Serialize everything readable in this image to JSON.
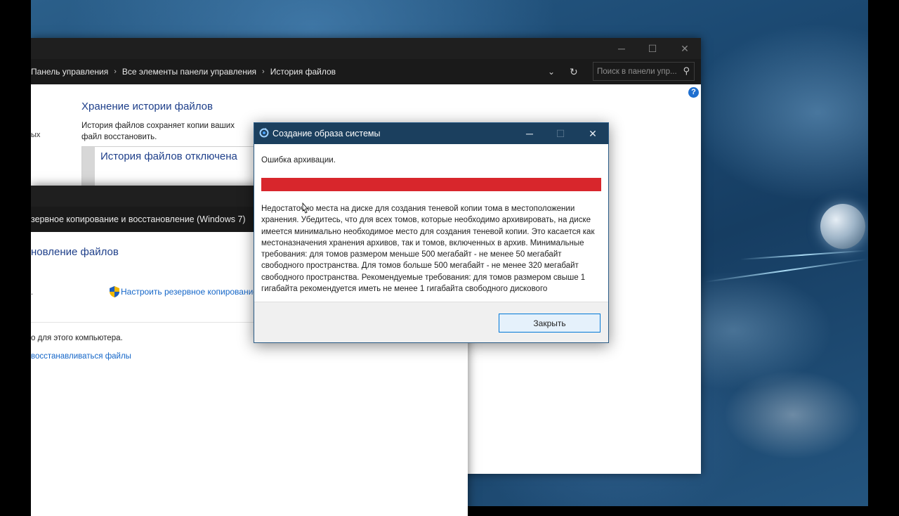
{
  "control_panel": {
    "breadcrumbs": [
      "Панель управления",
      "Все элементы панели управления",
      "История файлов"
    ],
    "search_placeholder": "Поиск в панели упр...",
    "help_label": "?",
    "heading": "Хранение истории файлов",
    "description": "История файлов сохраняет копии ваших файл восстановить.",
    "side_text": "ых",
    "status_title": "История файлов отключена"
  },
  "backup_window": {
    "address": "зервное копирование и восстановление (Windows 7)",
    "heading": "новление файлов",
    "dot_text": ".",
    "setup_link": "Настроить резервное копирование",
    "computer_text": "о для этого компьютера.",
    "restore_link": "восстанавливаться файлы"
  },
  "dialog": {
    "title": "Создание образа системы",
    "error_label": "Ошибка архивации.",
    "progress_fraction": 1.0,
    "error_color": "#d8262c",
    "message": "Недостаточно места на диске для создания теневой копии тома в местоположении хранения. Убедитесь, что для всех томов, которые необходимо архивировать, на диске имеется минимально необходимое место для создания теневой копии. Это касается как местоназначения хранения архивов, так и томов, включенных в архив. Минимальные требования: для томов размером меньше 500 мегабайт - не менее 50 мегабайт свободного пространства. Для томов больше 500 мегабайт - не менее 320 мегабайт свободного пространства. Рекомендуемые требования: для томов размером свыше 1 гигабайта рекомендуется иметь не менее 1 гигабайта свободного дискового",
    "close_button": "Закрыть"
  },
  "icons": {
    "minimize": "minimize-icon",
    "maximize": "maximize-icon",
    "close": "close-icon",
    "refresh": "refresh-icon",
    "search": "search-icon",
    "shield": "uac-shield-icon"
  }
}
